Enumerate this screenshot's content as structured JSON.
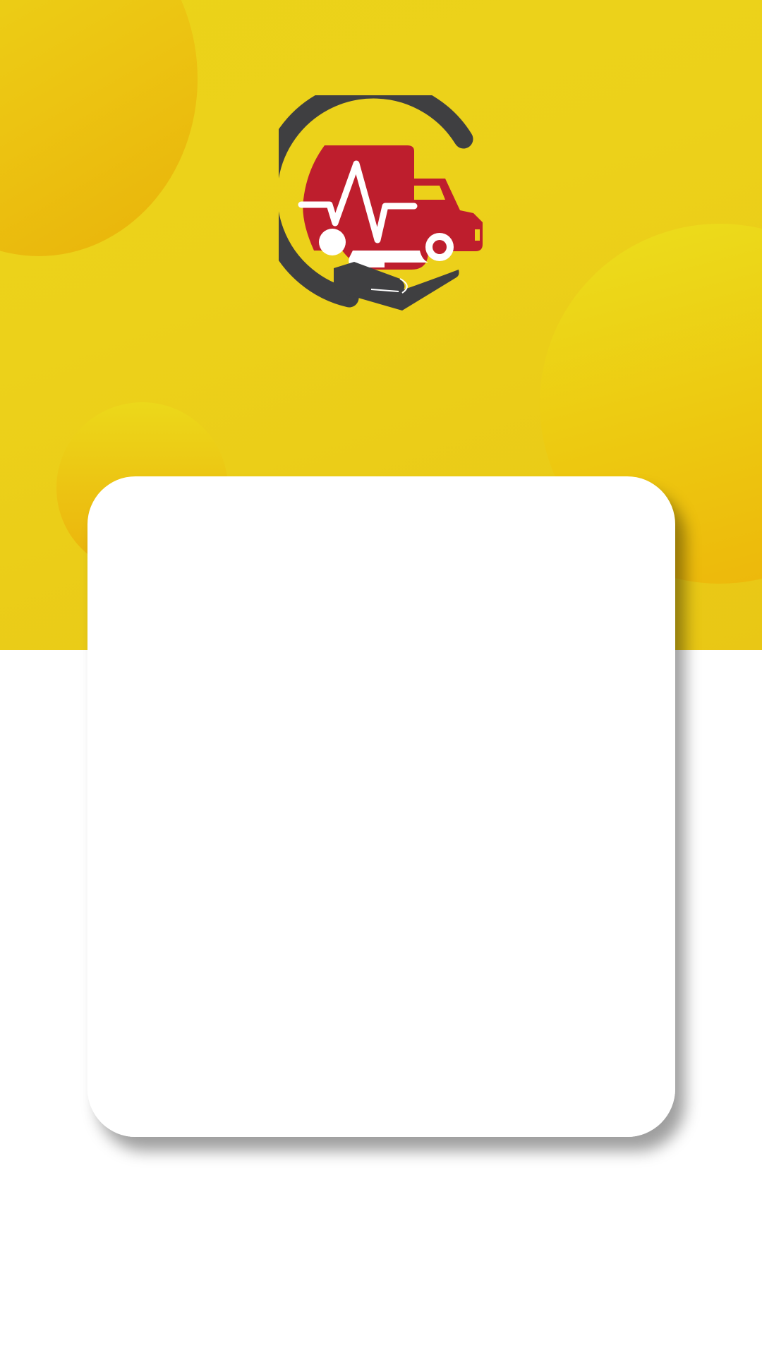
{
  "app": {
    "logo_icon": "ambulance-care-hand-icon"
  },
  "colors": {
    "hero_yellow": "#ecd11a",
    "bubble_orange": "#ecb50b",
    "logo_dark": "#3f3f41",
    "logo_red": "#be1e2d",
    "card_background": "#ffffff"
  },
  "card": {
    "content": ""
  }
}
